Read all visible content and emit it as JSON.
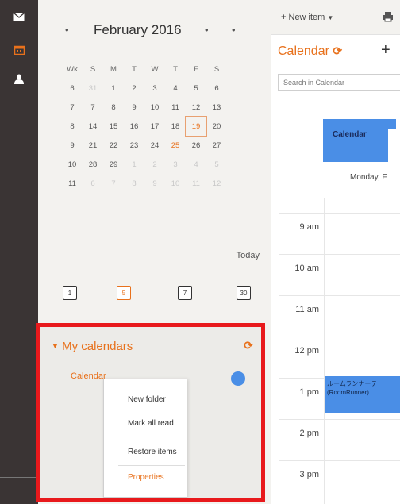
{
  "sidebar": {
    "mini_calendar": {
      "prev_arrow": "•",
      "month_title": "February 2016",
      "next_arrows": [
        "•",
        "•"
      ],
      "headers": [
        "Wk",
        "S",
        "M",
        "T",
        "W",
        "T",
        "F",
        "S"
      ],
      "weeks": [
        {
          "wk": "6",
          "days": [
            "31",
            "1",
            "2",
            "3",
            "4",
            "5",
            "6"
          ]
        },
        {
          "wk": "7",
          "days": [
            "7",
            "8",
            "9",
            "10",
            "11",
            "12",
            "13"
          ]
        },
        {
          "wk": "8",
          "days": [
            "14",
            "15",
            "16",
            "17",
            "18",
            "19",
            "20"
          ]
        },
        {
          "wk": "9",
          "days": [
            "21",
            "22",
            "23",
            "24",
            "25",
            "26",
            "27"
          ]
        },
        {
          "wk": "10",
          "days": [
            "28",
            "29",
            "1",
            "2",
            "3",
            "4",
            "5"
          ]
        },
        {
          "wk": "11",
          "days": [
            "6",
            "7",
            "8",
            "9",
            "10",
            "11",
            "12"
          ]
        }
      ],
      "today_label": "Today"
    },
    "view_buttons": [
      "1",
      "5",
      "7",
      "30"
    ],
    "my_calendars": {
      "label": "My calendars",
      "calendar_name": "Calendar"
    },
    "context_menu": {
      "new_folder": "New folder",
      "mark_all_read": "Mark all read",
      "restore_items": "Restore items",
      "properties": "Properties"
    }
  },
  "main": {
    "new_item_label": "New item",
    "calendar_title": "Calendar",
    "search_placeholder": "Search in Calendar",
    "tab_label": "Calendar",
    "day_header": "Monday, F",
    "time_slots": [
      "9 am",
      "10 am",
      "11 am",
      "12 pm",
      "1 pm",
      "2 pm",
      "3 pm"
    ],
    "event_text": "ルームランナーテ (RoomRunner)"
  },
  "colors": {
    "accent": "#e8711c",
    "event_blue": "#4a8ee6",
    "highlight_red": "#e8191c",
    "rail": "#3a3434"
  }
}
